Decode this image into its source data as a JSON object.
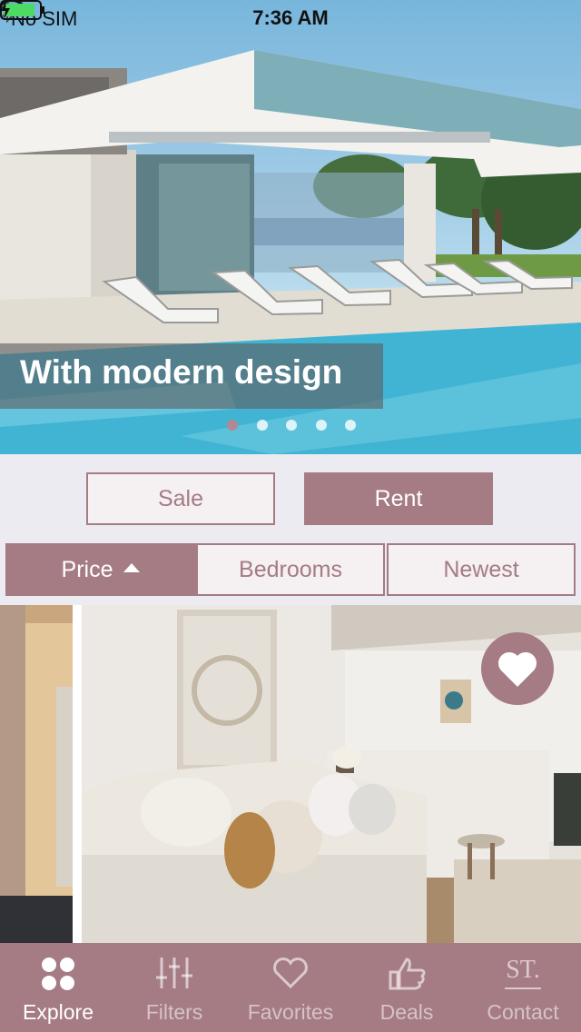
{
  "status_bar": {
    "carrier": "No SIM",
    "time": "7:36 AM"
  },
  "hero": {
    "caption": "With modern design",
    "page_count": 5,
    "active_page": 1
  },
  "mode": {
    "sale_label": "Sale",
    "rent_label": "Rent",
    "selected": "Rent"
  },
  "sort": {
    "price_label": "Price",
    "bedrooms_label": "Bedrooms",
    "newest_label": "Newest",
    "selected": "Price",
    "direction": "ascending"
  },
  "tabbar": {
    "items": [
      {
        "label": "Explore",
        "icon": "explore-icon"
      },
      {
        "label": "Filters",
        "icon": "sliders-icon"
      },
      {
        "label": "Favorites",
        "icon": "heart-icon"
      },
      {
        "label": "Deals",
        "icon": "thumbs-up-icon"
      },
      {
        "label": "Contact",
        "icon": "st-logo-icon",
        "icon_text": "ST."
      }
    ],
    "active": "Explore"
  },
  "colors": {
    "accent": "#a57b84",
    "background": "#ecebf1",
    "light_button": "#f5f0f2"
  }
}
